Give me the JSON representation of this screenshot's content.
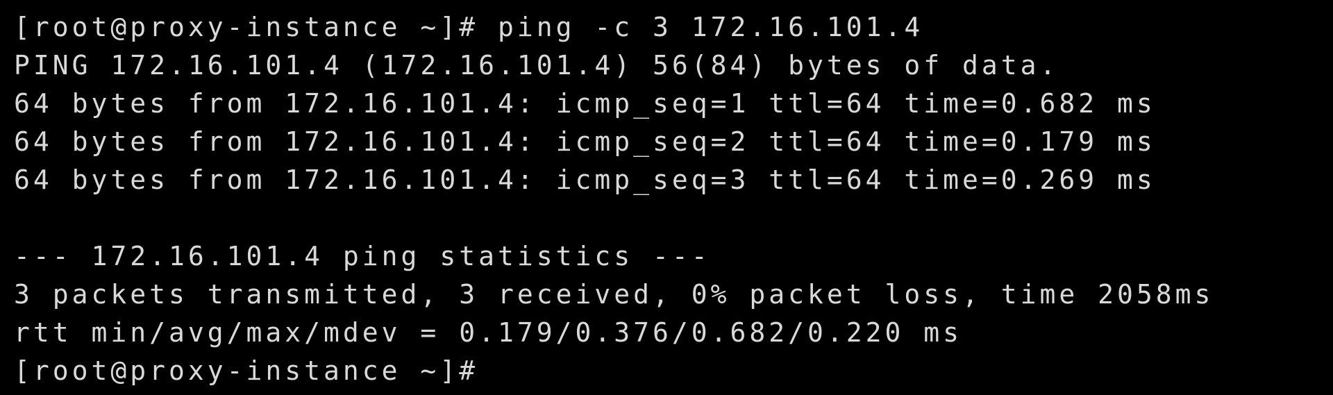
{
  "terminal": {
    "colors": {
      "background": "#000000",
      "text": "#d9d9d9"
    },
    "lines": [
      "[root@proxy-instance ~]# ping -c 3 172.16.101.4",
      "PING 172.16.101.4 (172.16.101.4) 56(84) bytes of data.",
      "64 bytes from 172.16.101.4: icmp_seq=1 ttl=64 time=0.682 ms",
      "64 bytes from 172.16.101.4: icmp_seq=2 ttl=64 time=0.179 ms",
      "64 bytes from 172.16.101.4: icmp_seq=3 ttl=64 time=0.269 ms",
      "",
      "--- 172.16.101.4 ping statistics ---",
      "3 packets transmitted, 3 received, 0% packet loss, time 2058ms",
      "rtt min/avg/max/mdev = 0.179/0.376/0.682/0.220 ms",
      "[root@proxy-instance ~]#"
    ]
  }
}
